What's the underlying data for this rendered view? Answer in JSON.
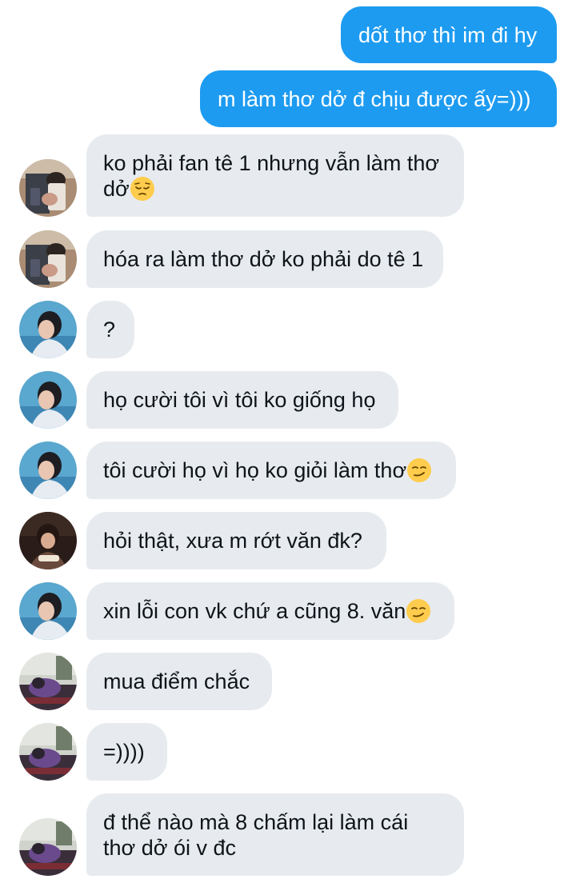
{
  "conversation": {
    "messages": [
      {
        "direction": "outgoing",
        "text": "dốt thơ thì im đi hy"
      },
      {
        "direction": "outgoing",
        "text": "m làm thơ dở đ chịu được ấy=)))"
      },
      {
        "direction": "incoming",
        "avatar": "selfie-mirror-avatar",
        "line1": "ko phải fan tê 1 nhưng vẫn làm thơ",
        "line2": "dở",
        "emoji": "pensive-face-emoji"
      },
      {
        "direction": "incoming",
        "avatar": "selfie-mirror-avatar",
        "text": "hóa ra làm thơ dở ko phải do tê 1"
      },
      {
        "direction": "incoming",
        "avatar": "boy-blue-sky-avatar",
        "text": "?"
      },
      {
        "direction": "incoming",
        "avatar": "boy-blue-sky-avatar",
        "text": "họ cười tôi vì tôi ko giống họ"
      },
      {
        "direction": "incoming",
        "avatar": "boy-blue-sky-avatar",
        "text": "tôi cười họ vì họ ko giỏi làm thơ",
        "emoji": "smirking-face-emoji"
      },
      {
        "direction": "incoming",
        "avatar": "person-eating-avatar",
        "text": "hỏi thật, xưa m rớt văn đk?"
      },
      {
        "direction": "incoming",
        "avatar": "boy-blue-sky-avatar",
        "text": "xin lỗi con vk chứ a cũng 8. văn",
        "emoji": "smirking-face-emoji"
      },
      {
        "direction": "incoming",
        "avatar": "purple-figure-avatar",
        "text": "mua điểm chắc"
      },
      {
        "direction": "incoming",
        "avatar": "purple-figure-avatar",
        "text": "=))))"
      },
      {
        "direction": "incoming",
        "avatar": "purple-figure-avatar",
        "line1": "đ thể nào mà 8 chấm lại làm cái",
        "line2": "thơ dở ói v đc"
      }
    ]
  },
  "colors": {
    "outgoing_bubble": "#1d9bf0",
    "incoming_bubble": "#e7ebef",
    "incoming_text": "#0f1419",
    "outgoing_text": "#ffffff",
    "background": "#ffffff"
  }
}
